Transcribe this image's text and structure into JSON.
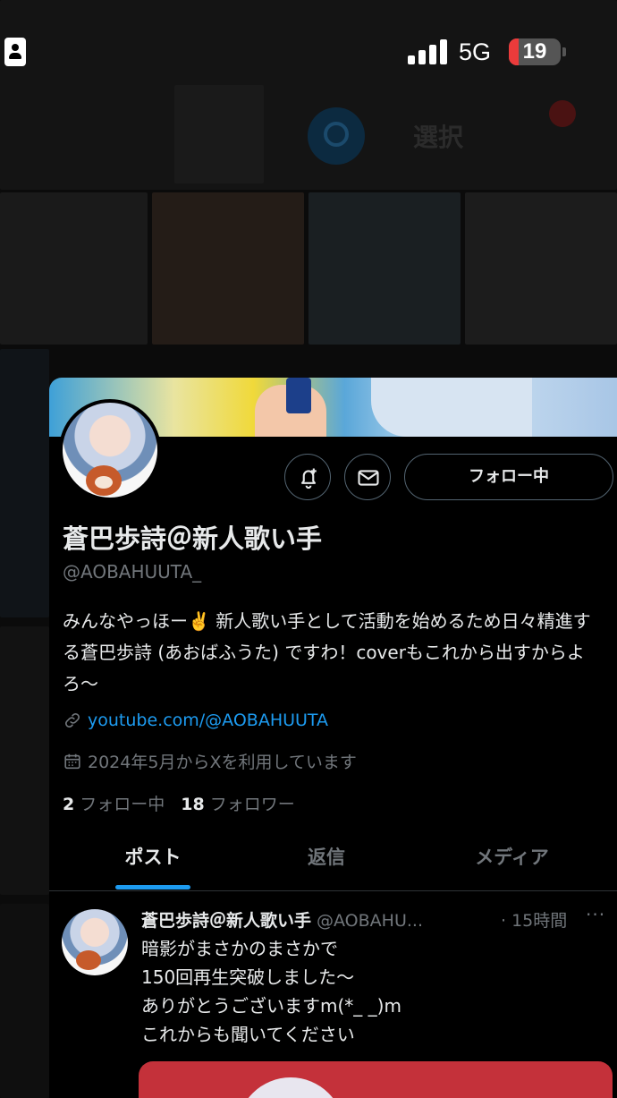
{
  "status_bar": {
    "network": "5G",
    "battery": "19",
    "battery_level": 0.19
  },
  "background": {
    "search_icon": "search-icon",
    "select_label": "選択"
  },
  "profile": {
    "display_name": "蒼巴歩詩＠新人歌い手",
    "handle": "@AOBAHUUTA_",
    "bio": "みんなやっほー✌️ 新人歌い手として活動を始めるため日々精進する蒼巴歩詩 (あおばふうた) ですわ！coverもこれから出すからよろ〜",
    "link": "youtube.com/@AOBAHUUTA",
    "joined": "2024年5月からXを利用しています",
    "following_count": "2",
    "following_label": "フォロー中",
    "followers_count": "18",
    "followers_label": "フォロワー",
    "follow_button": "フォロー中",
    "notify_icon": "bell-plus-icon",
    "message_icon": "mail-icon"
  },
  "tabs": [
    {
      "label": "ポスト",
      "active": true
    },
    {
      "label": "返信",
      "active": false
    },
    {
      "label": "メディア",
      "active": false
    }
  ],
  "post": {
    "name": "蒼巴歩詩＠新人歌い手",
    "handle": "@AOBAHU...",
    "time": "· 15時間",
    "more": "···",
    "lines": [
      "暗影がまさかのまさかで",
      "150回再生突破しました〜",
      "ありがとうございますm(*_ _)m",
      "これからも聞いてください"
    ]
  },
  "colors": {
    "background": "#000000",
    "text_primary": "#e7e9ea",
    "text_secondary": "#71767b",
    "accent": "#1d9bf0",
    "border": "#536471"
  }
}
